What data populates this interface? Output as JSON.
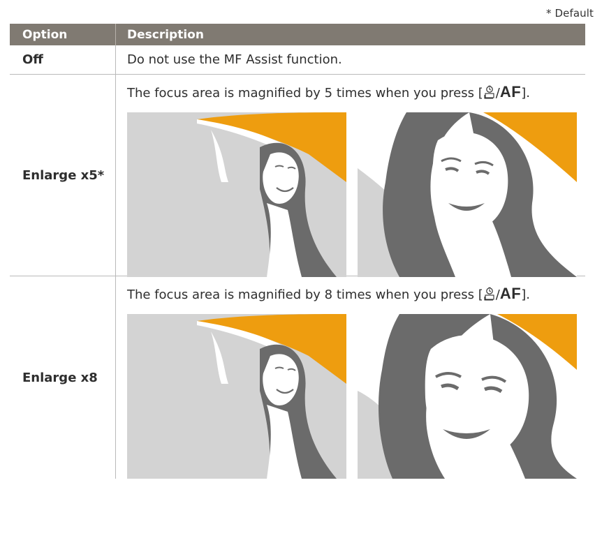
{
  "default_note": "* Default",
  "header": {
    "option": "Option",
    "description": "Description"
  },
  "rows": [
    {
      "option": "Off",
      "description": "Do not use the MF Assist function."
    },
    {
      "option": "Enlarge x5*",
      "description_prefix": "The focus area is magnified by 5 times when you press",
      "key_open": "[",
      "key_icon": "self-timer-icon",
      "key_separator": "/",
      "key_af": "AF",
      "key_close": "]."
    },
    {
      "option": "Enlarge x8",
      "description_prefix": "The focus area is magnified by 8 times when you press",
      "key_open": "[",
      "key_icon": "self-timer-icon",
      "key_separator": "/",
      "key_af": "AF",
      "key_close": "]."
    }
  ],
  "colors": {
    "header_bg": "#807a72",
    "photo_bg": "#d3d3d3",
    "umbrella": "#ee9d0f",
    "hair": "#6b6b6b"
  }
}
